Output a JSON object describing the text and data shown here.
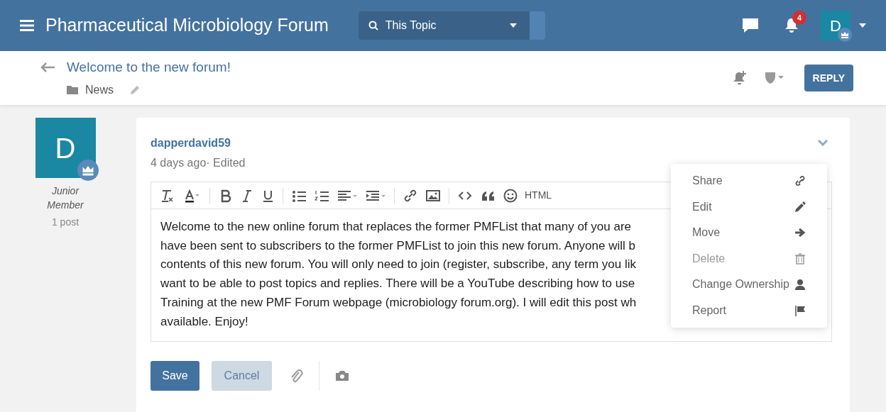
{
  "header": {
    "title": "Pharmaceutical Microbiology Forum",
    "search_scope": "This Topic",
    "notifications_count": "4",
    "avatar_letter": "D"
  },
  "topic": {
    "title": "Welcome to the new forum!",
    "category": "News",
    "reply_button": "REPLY"
  },
  "author": {
    "avatar_letter": "D",
    "rank": "Junior Member",
    "posts": "1 post"
  },
  "post": {
    "username": "dapperdavid59",
    "meta": "4 days ago· Edited"
  },
  "editor": {
    "toolbar": [
      {
        "kind": "clear-format"
      },
      {
        "kind": "text-color"
      },
      {
        "kind": "divider"
      },
      {
        "kind": "bold"
      },
      {
        "kind": "italic"
      },
      {
        "kind": "underline"
      },
      {
        "kind": "divider"
      },
      {
        "kind": "bullets"
      },
      {
        "kind": "numbers"
      },
      {
        "kind": "align"
      },
      {
        "kind": "indent"
      },
      {
        "kind": "divider"
      },
      {
        "kind": "link"
      },
      {
        "kind": "image"
      },
      {
        "kind": "divider"
      },
      {
        "kind": "code"
      },
      {
        "kind": "quote"
      },
      {
        "kind": "emoji"
      },
      {
        "kind": "html",
        "label": "HTML"
      }
    ],
    "lines": [
      "Welcome to the new online forum that replaces the former PMFList that many of you are",
      "have been sent to subscribers to the former PMFList to join this new forum. Anyone will b",
      "contents of this new forum. You will only need to join (register, subscribe, any term you lik",
      "want to be able to post topics and replies. There will be a YouTube describing how to use",
      "Training at the new PMF Forum webpage (microbiology forum.org). I will edit this post wh",
      "available. Enjoy!"
    ]
  },
  "actions": {
    "save": "Save",
    "cancel": "Cancel"
  },
  "post_menu": [
    {
      "label": "Share",
      "kind": "link",
      "disabled": false
    },
    {
      "label": "Edit",
      "kind": "pencil",
      "disabled": false
    },
    {
      "label": "Move",
      "kind": "arrow",
      "disabled": false
    },
    {
      "label": "Delete",
      "kind": "trash",
      "disabled": true
    },
    {
      "label": "Change Ownership",
      "kind": "person",
      "disabled": false
    },
    {
      "label": "Report",
      "kind": "flag",
      "disabled": false
    }
  ]
}
